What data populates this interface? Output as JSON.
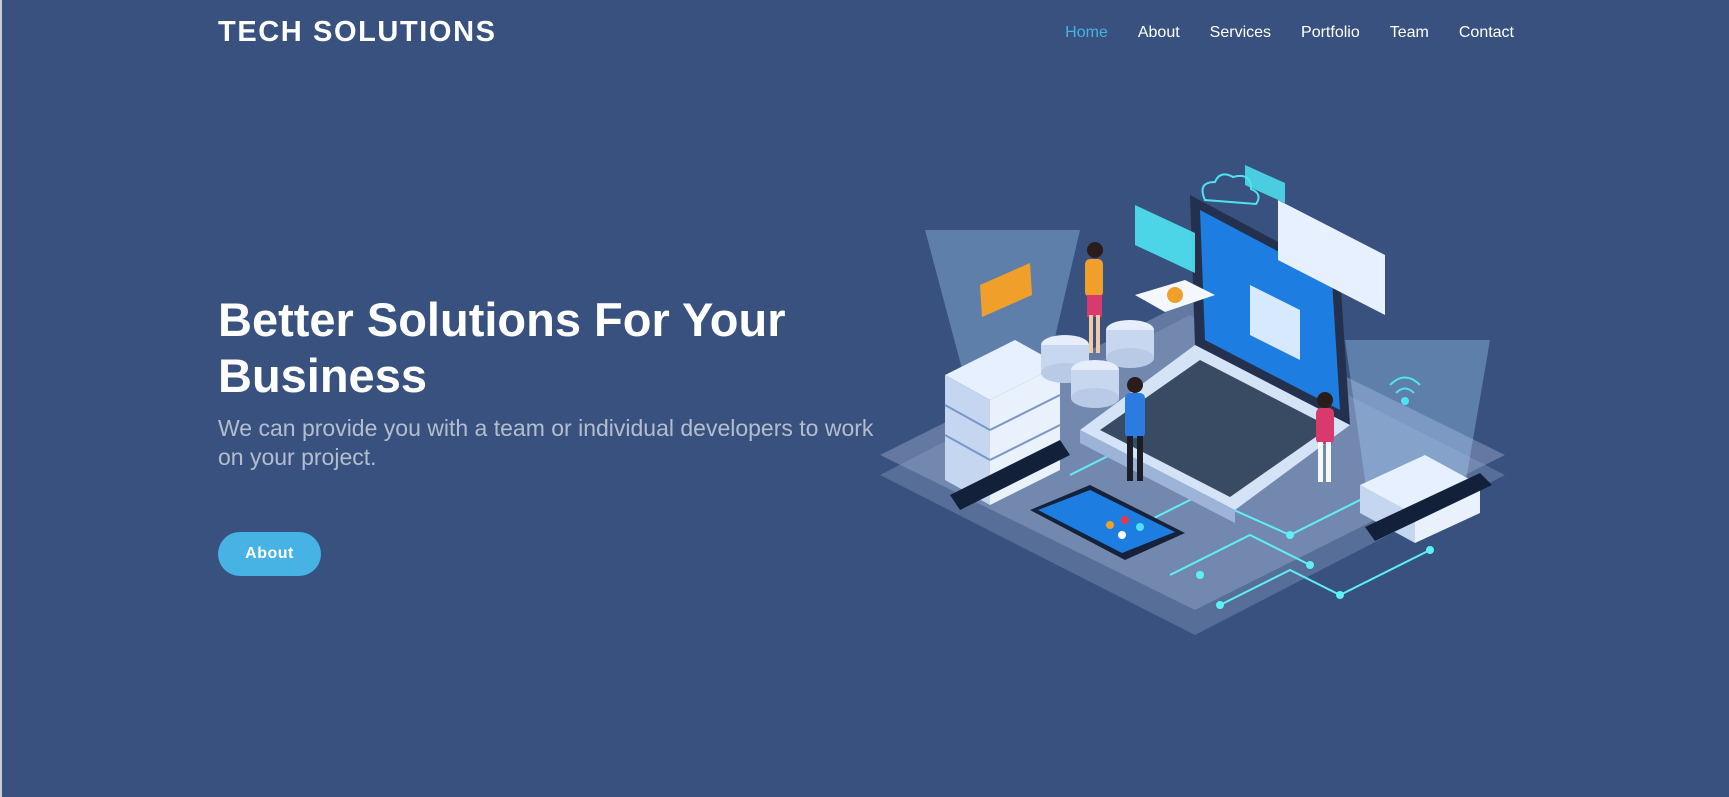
{
  "header": {
    "logo": "TECH SOLUTIONS",
    "nav": [
      "Home",
      "About",
      "Services",
      "Portfolio",
      "Team",
      "Contact"
    ],
    "active_nav": "Home"
  },
  "hero": {
    "title": "Better Solutions For Your Business",
    "subtitle": "We can provide you with a team or individual developers to work on your project.",
    "button_label": "About",
    "illustration": "isometric-tech-illustration"
  },
  "colors": {
    "background": "#38517e",
    "accent": "#47b2e4",
    "text": "#ffffff"
  }
}
